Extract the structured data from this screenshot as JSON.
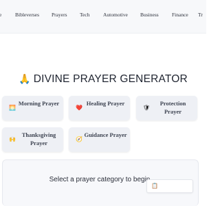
{
  "nav": {
    "items": [
      {
        "label": "e"
      },
      {
        "label": "Bibleverses"
      },
      {
        "label": "Prayers"
      },
      {
        "label": "Tech"
      },
      {
        "label": "Automotive"
      },
      {
        "label": "Business"
      },
      {
        "label": "Finance"
      },
      {
        "label": "Tr"
      }
    ]
  },
  "title": {
    "icon": "🙏",
    "text": "DIVINE PRAYER GENERATOR"
  },
  "categories": [
    {
      "label": "Morning Prayer",
      "icon": "🌅",
      "icon_name": "sunrise-icon"
    },
    {
      "label": "Healing Prayer",
      "icon": "❤️",
      "icon_name": "heart-icon"
    },
    {
      "label": "Protection Prayer",
      "icon": "🛡",
      "icon_name": "shield-icon"
    },
    {
      "label": "Thanksgiving Prayer",
      "icon": "🙌",
      "icon_name": "raised-hands-icon"
    },
    {
      "label": "Guidance Prayer",
      "icon": "🧭",
      "icon_name": "compass-icon"
    }
  ],
  "output": {
    "prompt": "Select a prayer category to begin",
    "copy_icon": "📋",
    "copy_icon_name": "clipboard-icon"
  }
}
